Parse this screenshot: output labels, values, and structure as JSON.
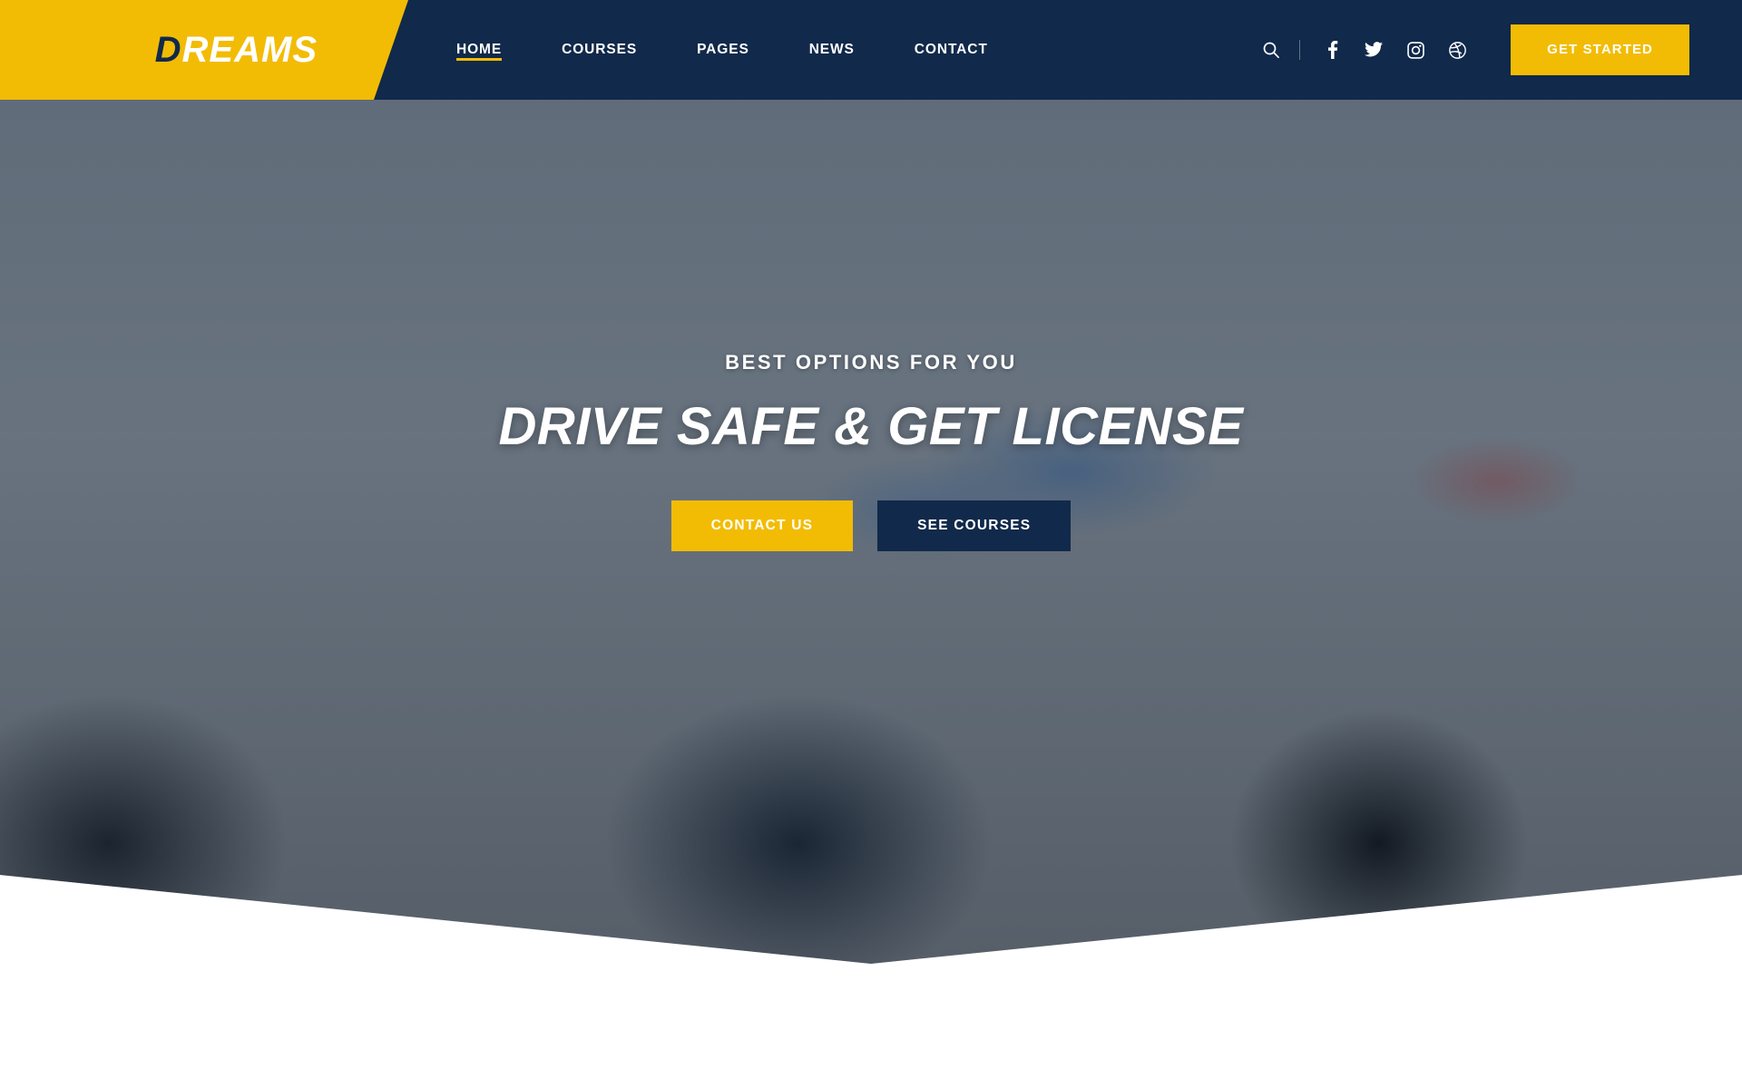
{
  "header": {
    "logo": {
      "first_letter": "D",
      "rest": "REAMS",
      "full": "DREAMS"
    },
    "nav": [
      {
        "label": "HOME",
        "active": true
      },
      {
        "label": "COURSES",
        "active": false
      },
      {
        "label": "PAGES",
        "active": false
      },
      {
        "label": "NEWS",
        "active": false
      },
      {
        "label": "CONTACT",
        "active": false
      }
    ],
    "search_icon": "search-icon",
    "social": [
      {
        "name": "facebook-icon",
        "label": "Facebook"
      },
      {
        "name": "twitter-icon",
        "label": "Twitter"
      },
      {
        "name": "instagram-icon",
        "label": "Instagram"
      },
      {
        "name": "dribbble-icon",
        "label": "Dribbble"
      }
    ],
    "cta_label": "GET STARTED"
  },
  "hero": {
    "subtitle": "BEST OPTIONS FOR YOU",
    "title": "DRIVE SAFE & GET LICENSE",
    "primary_button": "CONTACT US",
    "secondary_button": "SEE COURSES"
  },
  "colors": {
    "accent_yellow": "#f2bc05",
    "navy": "#11294a",
    "white": "#ffffff",
    "page_background": "#ffffff"
  }
}
